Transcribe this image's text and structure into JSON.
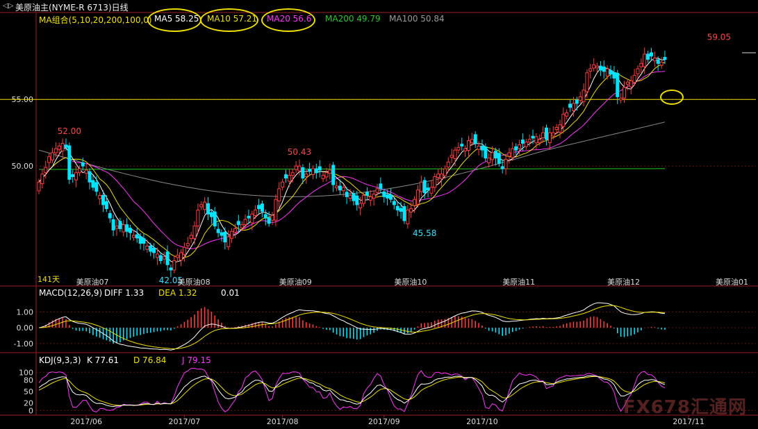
{
  "header": {
    "title": "美原油主(NYME-R 6713)日线"
  },
  "legend": {
    "ma_group": "MA组合(5,10,20,200,100,0)",
    "ma5": "MA5 58.25",
    "ma10": "MA10 57.21",
    "ma20": "MA20 56.6",
    "ma200": "MA200 49.79",
    "ma100": "MA100 50.84"
  },
  "macd_legend": {
    "name": "MACD(12,26,9)",
    "diff": "DIFF  1.33",
    "dea": "DEA  1.32",
    "macd": "0.01"
  },
  "kdj_legend": {
    "name": "KDJ(9,3,3)",
    "k": "K  77.61",
    "d": "D  76.84",
    "j": "J  79.15"
  },
  "watermark": "FX678汇通网",
  "colors": {
    "up": "#ff3b3b",
    "down": "#00e5ff",
    "ma5": "#ffffff",
    "ma10": "#f0e000",
    "ma20": "#ff33ff",
    "ma200": "#22cc22",
    "ma100": "#8a8a8a",
    "highlight": "#f0e000",
    "axis": "#a01c1c"
  },
  "chart_data": [
    {
      "type": "candlestick",
      "title": "美原油主(NYME-R 6713)日线",
      "ylim": [
        41.0,
        61.0
      ],
      "y_ticks": [
        50.0,
        55.0
      ],
      "y_tick_labels": [
        "50.00",
        "55.00"
      ],
      "reference_line": 55.0,
      "contract_labels": [
        "美原油07",
        "美原油08",
        "美原油09",
        "美原油10",
        "美原油11",
        "美原油12",
        "美原油01"
      ],
      "contract_label_x": [
        11,
        41,
        71,
        105,
        137,
        168,
        200
      ],
      "bar_count_label": "141天",
      "annotations": [
        {
          "label": "52.00",
          "x": 9,
          "y": 52.0,
          "kind": "high"
        },
        {
          "label": "42.05",
          "x": 39,
          "y": 42.05,
          "kind": "low"
        },
        {
          "label": "50.43",
          "x": 77,
          "y": 50.43,
          "kind": "high"
        },
        {
          "label": "45.58",
          "x": 114,
          "y": 45.58,
          "kind": "low"
        },
        {
          "label": "59.05",
          "x": 201,
          "y": 59.05,
          "kind": "high"
        }
      ],
      "close": [
        48.8,
        49.4,
        49.9,
        50.7,
        51.0,
        51.3,
        51.5,
        51.7,
        51.4,
        49.0,
        49.2,
        49.5,
        49.8,
        50.0,
        49.7,
        48.8,
        48.4,
        48.1,
        47.8,
        47.1,
        46.8,
        46.1,
        45.2,
        45.5,
        45.3,
        45.6,
        45.1,
        45.0,
        44.8,
        44.6,
        44.2,
        44.2,
        44.0,
        43.6,
        43.5,
        43.4,
        42.9,
        43.2,
        42.6,
        42.2,
        42.9,
        43.3,
        43.5,
        43.9,
        44.2,
        44.8,
        45.5,
        46.7,
        47.1,
        47.3,
        46.4,
        46.2,
        45.5,
        45.0,
        44.8,
        44.3,
        44.7,
        45.1,
        45.3,
        45.6,
        45.6,
        46.0,
        46.1,
        46.4,
        46.7,
        46.8,
        46.6,
        46.1,
        45.7,
        46.3,
        47.5,
        48.3,
        48.8,
        49.1,
        49.3,
        49.5,
        50.0,
        50.0,
        49.1,
        49.4,
        49.6,
        49.8,
        49.5,
        49.7,
        49.3,
        49.5,
        49.7,
        48.6,
        48.5,
        48.2,
        48.4,
        47.7,
        47.8,
        47.4,
        47.1,
        47.2,
        47.8,
        47.8,
        47.7,
        47.9,
        48.3,
        48.3,
        47.7,
        47.6,
        47.5,
        47.1,
        46.7,
        46.6,
        45.9,
        46.7,
        46.8,
        47.5,
        48.2,
        48.8,
        48.0,
        48.2,
        48.4,
        49.2,
        49.4,
        49.4,
        49.8,
        50.3,
        50.8,
        51.2,
        51.4,
        51.5,
        51.3,
        51.9,
        52.0,
        51.7,
        51.5,
        51.2,
        50.6,
        50.6,
        51.0,
        50.6,
        50.2,
        49.8,
        50.5,
        51.0,
        51.3,
        51.2,
        51.6,
        51.7,
        51.8,
        52.0,
        52.1,
        52.2,
        52.0,
        52.5,
        52.0,
        52.5,
        52.5,
        52.9,
        53.1,
        53.9,
        54.0,
        54.4,
        54.7,
        54.7,
        55.2,
        55.7,
        57.0,
        57.3,
        57.6,
        57.5,
        57.2,
        57.1,
        57.3,
        56.9,
        56.6,
        55.2,
        55.1,
        55.9,
        56.3,
        56.4,
        56.8,
        57.3,
        57.7,
        58.4,
        58.0,
        58.25,
        58.1,
        57.7,
        57.8,
        58.0
      ],
      "bar_direction": "derived from open/close; red = up, cyan = down"
    },
    {
      "type": "bar+line",
      "title": "MACD(12,26,9)",
      "ylim": [
        -1.4,
        1.5
      ],
      "y_ticks": [
        1.0,
        0.0,
        -1.0
      ],
      "y_tick_labels": [
        "1.00",
        "0.00",
        "-1.00"
      ],
      "series": [
        {
          "name": "DIFF",
          "last": 1.33
        },
        {
          "name": "DEA",
          "last": 1.32
        },
        {
          "name": "MACD",
          "last": 0.01
        }
      ]
    },
    {
      "type": "line",
      "title": "KDJ(9,3,3)",
      "ylim": [
        -5,
        115
      ],
      "y_ticks": [
        100,
        80,
        50,
        20,
        0
      ],
      "y_tick_labels": [
        "100",
        "80",
        "50",
        "20",
        "0"
      ],
      "series": [
        {
          "name": "K",
          "last": 77.61
        },
        {
          "name": "D",
          "last": 76.84
        },
        {
          "name": "J",
          "last": 79.15
        }
      ],
      "x_ticks": [
        "2017/06",
        "2017/07",
        "2017/08",
        "2017/09",
        "2017/10",
        "2017/11"
      ],
      "x_tick_index": [
        14,
        43,
        72,
        102,
        131,
        192
      ]
    }
  ]
}
